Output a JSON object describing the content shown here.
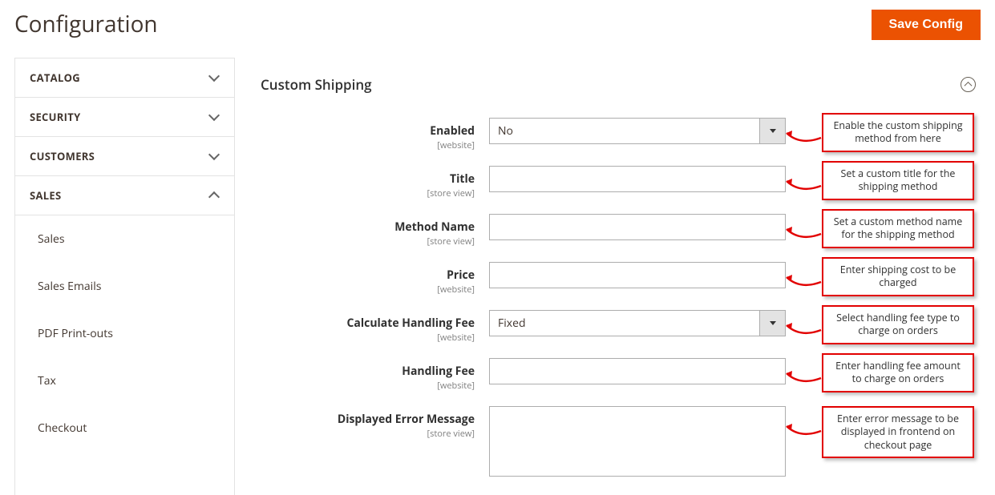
{
  "page": {
    "title": "Configuration",
    "save_label": "Save Config"
  },
  "sidebar": {
    "sections": [
      {
        "label": "CATALOG",
        "expanded": false
      },
      {
        "label": "SECURITY",
        "expanded": false
      },
      {
        "label": "CUSTOMERS",
        "expanded": false
      },
      {
        "label": "SALES",
        "expanded": true
      }
    ],
    "sales_items": [
      {
        "label": "Sales"
      },
      {
        "label": "Sales Emails"
      },
      {
        "label": "PDF Print-outs"
      },
      {
        "label": "Tax"
      },
      {
        "label": "Checkout"
      }
    ]
  },
  "section": {
    "title": "Custom Shipping"
  },
  "fields": {
    "enabled": {
      "label": "Enabled",
      "scope": "[website]",
      "value": "No"
    },
    "title": {
      "label": "Title",
      "scope": "[store view]",
      "value": ""
    },
    "method_name": {
      "label": "Method Name",
      "scope": "[store view]",
      "value": ""
    },
    "price": {
      "label": "Price",
      "scope": "[website]",
      "value": ""
    },
    "calc_handling": {
      "label": "Calculate Handling Fee",
      "scope": "[website]",
      "value": "Fixed"
    },
    "handling_fee": {
      "label": "Handling Fee",
      "scope": "[website]",
      "value": ""
    },
    "error_msg": {
      "label": "Displayed Error Message",
      "scope": "[store view]",
      "value": ""
    }
  },
  "callouts": {
    "enabled": "Enable the custom shipping method from here",
    "title": "Set a custom title for the shipping method",
    "method_name": "Set a custom method name for the shipping method",
    "price": "Enter shipping cost to be charged",
    "calc_handling": "Select handling fee type to charge on orders",
    "handling_fee": "Enter handling fee amount to charge on orders",
    "error_msg": "Enter error message to be displayed in frontend on checkout page"
  }
}
